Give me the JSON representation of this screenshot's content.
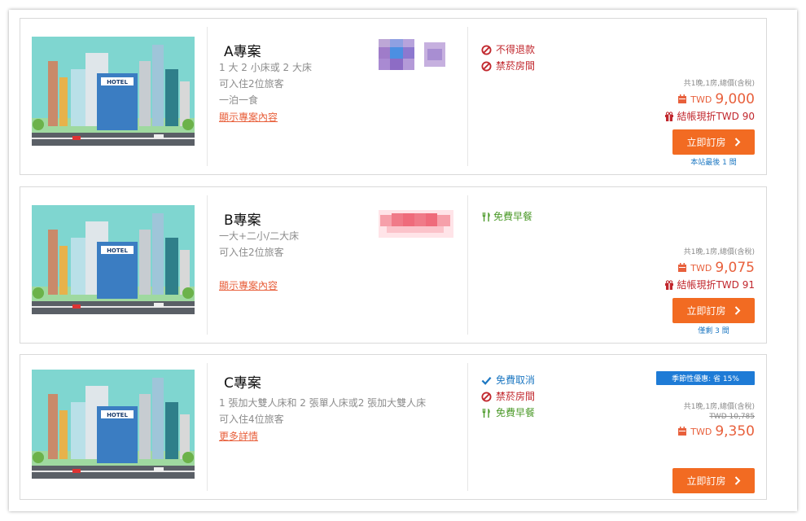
{
  "plans": [
    {
      "title": "A專案",
      "details": [
        "1 大 2 小床或 2 大床",
        "可入住2位旅客",
        "一泊一食"
      ],
      "link": "顯示專案內容",
      "features": [
        {
          "icon": "no-icon",
          "text": "不得退款"
        },
        {
          "icon": "no-icon",
          "text": "禁菸房間"
        }
      ],
      "price_note": "共1晚,1房,總價(含稅)",
      "currency": "TWD",
      "price": "9,000",
      "cashback": "結帳現折TWD 90",
      "button": "立即訂房",
      "stock": "本站最後 1 間"
    },
    {
      "title": "B專案",
      "details": [
        "一大+二小/二大床",
        "可入住2位旅客"
      ],
      "link": "顯示專案內容",
      "features": [
        {
          "icon": "fork-knife-icon",
          "text": "免費早餐"
        }
      ],
      "price_note": "共1晚,1房,總價(含稅)",
      "currency": "TWD",
      "price": "9,075",
      "cashback": "結帳現折TWD 91",
      "button": "立即訂房",
      "stock": "僅剩 3 間"
    },
    {
      "title": "C專案",
      "details": [
        "1 張加大雙人床和 2 張單人床或2 張加大雙人床",
        "可入住4位旅客"
      ],
      "link": "更多詳情",
      "features": [
        {
          "icon": "check-icon",
          "text": "免費取消"
        },
        {
          "icon": "no-icon",
          "text": "禁菸房間"
        },
        {
          "icon": "fork-knife-icon",
          "text": "免費早餐"
        }
      ],
      "badge": "季節性優惠: 省 15%",
      "price_note": "共1晚,1房,總價(含稅)",
      "old_price": "TWD 10,785",
      "currency": "TWD",
      "price": "9,350",
      "button": "立即訂房"
    }
  ],
  "hotel_sign": "HOTEL",
  "colors": {
    "accent": "#f26b22",
    "price": "#e8603c",
    "red": "#c1272d",
    "green": "#4c9a2a",
    "blue": "#1e78c2"
  }
}
